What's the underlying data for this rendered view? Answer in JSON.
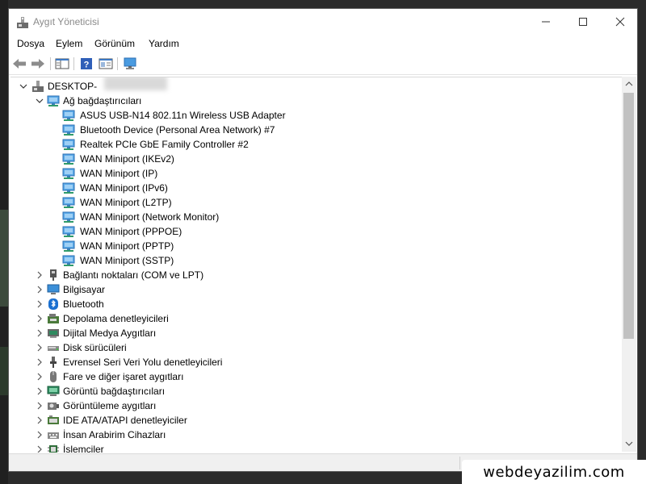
{
  "window": {
    "title": "Aygıt Yöneticisi"
  },
  "menu": [
    "Dosya",
    "Eylem",
    "Görünüm",
    "Yardım"
  ],
  "tree": {
    "root": "DESKTOP-",
    "network": {
      "label": "Ağ bağdaştırıcıları",
      "children": [
        "ASUS USB-N14 802.11n Wireless USB Adapter",
        "Bluetooth Device (Personal Area Network) #7",
        "Realtek PCIe GbE Family Controller #2",
        "WAN Miniport (IKEv2)",
        "WAN Miniport (IP)",
        "WAN Miniport (IPv6)",
        "WAN Miniport (L2TP)",
        "WAN Miniport (Network Monitor)",
        "WAN Miniport (PPPOE)",
        "WAN Miniport (PPTP)",
        "WAN Miniport (SSTP)"
      ]
    },
    "categories": [
      "Bağlantı noktaları (COM ve LPT)",
      "Bilgisayar",
      "Bluetooth",
      "Depolama denetleyicileri",
      "Dijital Medya Aygıtları",
      "Disk sürücüleri",
      "Evrensel Seri Veri Yolu denetleyicileri",
      "Fare ve diğer işaret aygıtları",
      "Görüntü bağdaştırıcıları",
      "Görüntüleme aygıtları",
      "IDE ATA/ATAPI denetleyiciler",
      "İnsan Arabirim Cihazları",
      "İşlemciler"
    ]
  },
  "watermark": "webdeyazilim.com",
  "icons": {
    "category_icons": [
      "port-icon",
      "computer-icon",
      "bluetooth-icon",
      "storage-controller-icon",
      "digital-media-icon",
      "disk-drive-icon",
      "usb-icon",
      "mouse-icon",
      "display-adapter-icon",
      "imaging-device-icon",
      "ide-controller-icon",
      "hid-icon",
      "processor-icon"
    ]
  },
  "colors": {
    "network_icon": "#3a8fd4",
    "bluetooth": "#1a6fd0",
    "accent": "#0078d7"
  }
}
